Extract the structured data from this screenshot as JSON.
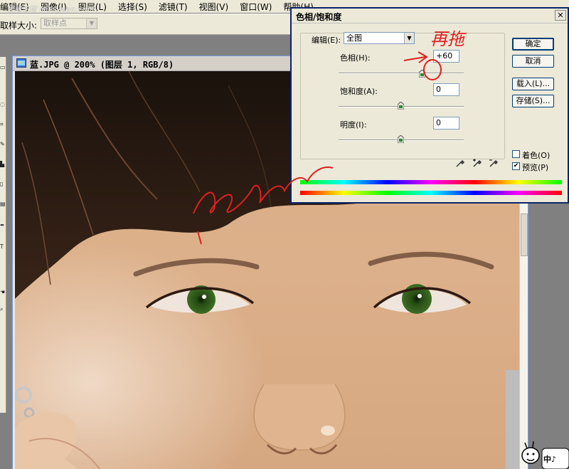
{
  "watermark": "思缘论坛 Missyuan.com",
  "menubar": {
    "items": [
      "编辑(E)",
      "图像(I)",
      "图层(L)",
      "选择(S)",
      "滤镜(T)",
      "视图(V)",
      "窗口(W)",
      "帮助(H)"
    ]
  },
  "options": {
    "sample_size_label": "取样大小:",
    "sample_size_value": "取样点"
  },
  "document": {
    "title": "蓝.JPG @ 200% (图层 1, RGB/8)"
  },
  "dialog": {
    "title": "色相/饱和度",
    "edit_label": "编辑(E):",
    "edit_value": "全图",
    "hue_label": "色相(H):",
    "hue_value": "+60",
    "hue_level": 60,
    "saturation_label": "饱和度(A):",
    "saturation_value": "0",
    "lightness_label": "明度(I):",
    "lightness_value": "0",
    "buttons": {
      "ok": "确定",
      "cancel": "取消",
      "load": "载入(L)...",
      "save": "存储(S)..."
    },
    "colorize_label": "着色(O)",
    "colorize_checked": false,
    "preview_label": "预览(P)",
    "preview_checked": true
  },
  "annotations": {
    "handwritten_top": "再拖"
  },
  "mascot": {
    "text": "中♪"
  },
  "colors": {
    "annotation_red": "#e02020",
    "title_bg": "#ece9d8",
    "window_blue": "#0a246a"
  },
  "icons": [
    "close-icon",
    "dropdown-arrow-icon",
    "slider-thumb-icon",
    "eyedropper-icon",
    "eyedropper-plus-icon",
    "eyedropper-minus-icon",
    "document-icon",
    "checkmark-icon"
  ]
}
